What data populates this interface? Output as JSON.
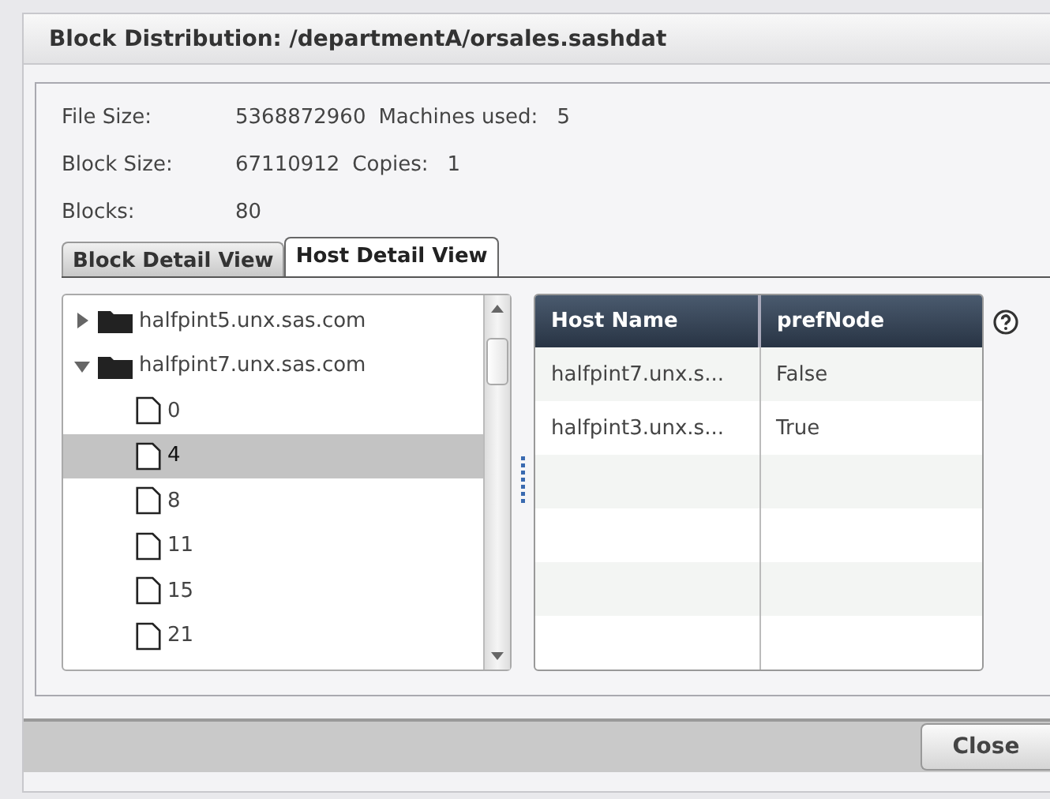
{
  "window": {
    "title": "Block Distribution: /departmentA/orsales.sashdat"
  },
  "info": [
    {
      "label": "File Size:",
      "value": "5368872960",
      "extra_label": "Machines used:",
      "extra_value": "5"
    },
    {
      "label": "Block Size:",
      "value": "67110912",
      "extra_label": "Copies:",
      "extra_value": "1"
    },
    {
      "label": "Blocks:",
      "value": "80"
    }
  ],
  "tabs": [
    {
      "label": "Block Detail View",
      "selected": false
    },
    {
      "label": "Host Detail View",
      "selected": true
    }
  ],
  "tree": [
    {
      "label": "halfpint5.unx.sas.com",
      "expanded": false,
      "selected": false
    },
    {
      "label": "halfpint7.unx.sas.com",
      "expanded": true,
      "selected": false,
      "children": [
        {
          "label": "0",
          "selected": false
        },
        {
          "label": "4",
          "selected": true
        },
        {
          "label": "8",
          "selected": false
        },
        {
          "label": "11",
          "selected": false
        },
        {
          "label": "15",
          "selected": false
        },
        {
          "label": "21",
          "selected": false
        }
      ]
    }
  ],
  "table": {
    "columns": [
      "Host Name",
      "prefNode"
    ],
    "rows": [
      [
        "halfpint7.unx.s...",
        "False"
      ],
      [
        "halfpint3.unx.s...",
        "True"
      ]
    ]
  },
  "buttons": [
    "Close"
  ]
}
